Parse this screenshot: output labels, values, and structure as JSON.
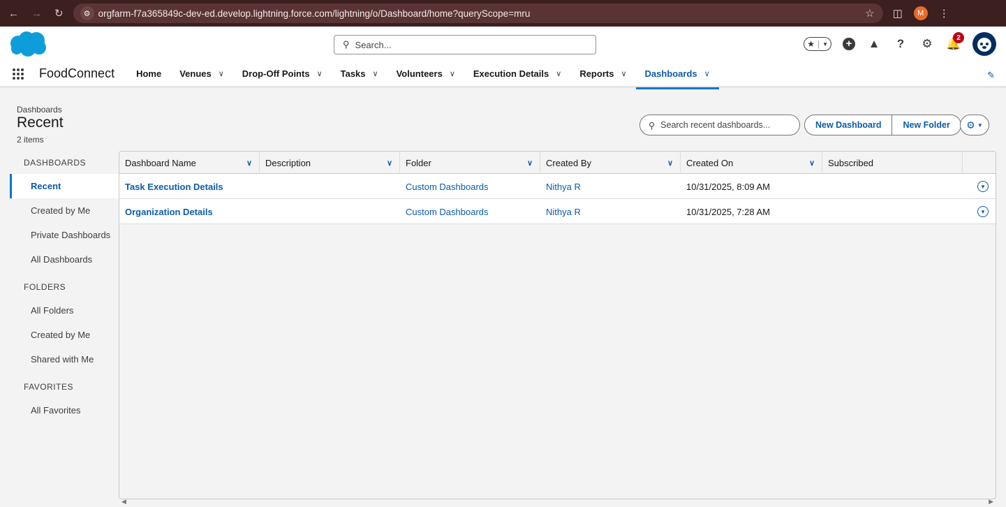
{
  "browser": {
    "url": "orgfarm-f7a365849c-dev-ed.develop.lightning.force.com/lightning/o/Dashboard/home?queryScope=mru",
    "profile_initial": "M"
  },
  "header": {
    "search_placeholder": "Search...",
    "notification_count": "2"
  },
  "appnav": {
    "app_name": "FoodConnect",
    "items": [
      {
        "label": "Home"
      },
      {
        "label": "Venues"
      },
      {
        "label": "Drop-Off Points"
      },
      {
        "label": "Tasks"
      },
      {
        "label": "Volunteers"
      },
      {
        "label": "Execution Details"
      },
      {
        "label": "Reports"
      },
      {
        "label": "Dashboards"
      }
    ]
  },
  "page": {
    "eyebrow": "Dashboards",
    "title": "Recent",
    "count": "2 items",
    "search_placeholder": "Search recent dashboards...",
    "new_dashboard_label": "New Dashboard",
    "new_folder_label": "New Folder"
  },
  "sidebar": {
    "dashboards_heading": "DASHBOARDS",
    "dashboards_items": [
      "Recent",
      "Created by Me",
      "Private Dashboards",
      "All Dashboards"
    ],
    "folders_heading": "FOLDERS",
    "folders_items": [
      "All Folders",
      "Created by Me",
      "Shared with Me"
    ],
    "favorites_heading": "FAVORITES",
    "favorites_items": [
      "All Favorites"
    ]
  },
  "table": {
    "columns": [
      "Dashboard Name",
      "Description",
      "Folder",
      "Created By",
      "Created On",
      "Subscribed"
    ],
    "rows": [
      {
        "name": "Task Execution Details",
        "description": "",
        "folder": "Custom Dashboards",
        "created_by": "Nithya R",
        "created_on": "10/31/2025, 8:09 AM",
        "subscribed": ""
      },
      {
        "name": "Organization Details",
        "description": "",
        "folder": "Custom Dashboards",
        "created_by": "Nithya R",
        "created_on": "10/31/2025, 7:28 AM",
        "subscribed": ""
      }
    ]
  },
  "colors": {
    "brand_blue": "#0176d3",
    "link_blue": "#0b5cab",
    "browser_bar": "#3c1f1f",
    "badge_red": "#ba0517"
  }
}
